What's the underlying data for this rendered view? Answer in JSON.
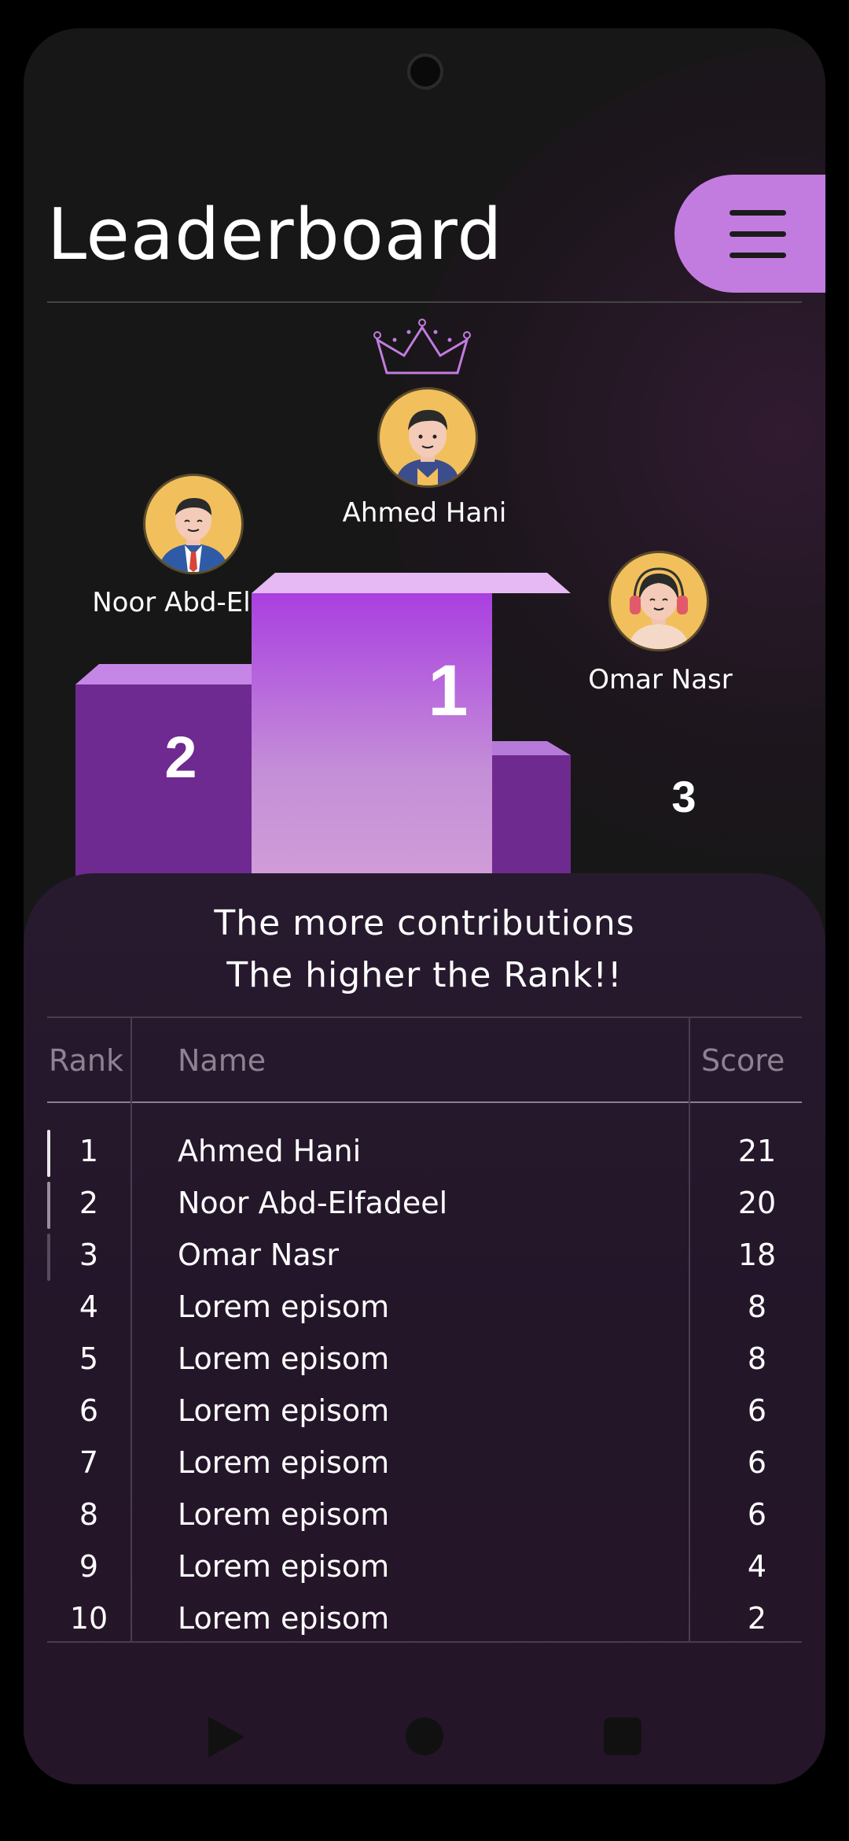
{
  "header": {
    "title": "Leaderboard",
    "menu_icon": "hamburger-menu-icon"
  },
  "podium": {
    "first": {
      "name": "Ahmed Hani",
      "place": "1"
    },
    "second": {
      "name": "Noor Abd-El.....",
      "place": "2"
    },
    "third": {
      "name": "Omar Nasr",
      "place": "3"
    }
  },
  "tagline": {
    "line1": "The more contributions",
    "line2": "The higher the Rank!!"
  },
  "table": {
    "headers": {
      "rank": "Rank",
      "name": "Name",
      "score": "Score"
    },
    "rows": [
      {
        "rank": "1",
        "name": "Ahmed Hani",
        "score": "21"
      },
      {
        "rank": "2",
        "name": "Noor Abd-Elfadeel",
        "score": "20"
      },
      {
        "rank": "3",
        "name": "Omar Nasr",
        "score": "18"
      },
      {
        "rank": "4",
        "name": "Lorem episom",
        "score": "8"
      },
      {
        "rank": "5",
        "name": "Lorem episom",
        "score": "8"
      },
      {
        "rank": "6",
        "name": "Lorem episom",
        "score": "6"
      },
      {
        "rank": "7",
        "name": "Lorem episom",
        "score": "6"
      },
      {
        "rank": "8",
        "name": "Lorem episom",
        "score": "6"
      },
      {
        "rank": "9",
        "name": "Lorem episom",
        "score": "4"
      },
      {
        "rank": "10",
        "name": "Lorem episom",
        "score": "2"
      }
    ]
  },
  "colors": {
    "accent": "#c27ce0",
    "podium": "#9b3fd0",
    "background": "#171717",
    "panel": "#251528"
  },
  "nav": {
    "back_icon": "back-triangle-icon",
    "home_icon": "home-circle-icon",
    "recents_icon": "recents-square-icon"
  }
}
